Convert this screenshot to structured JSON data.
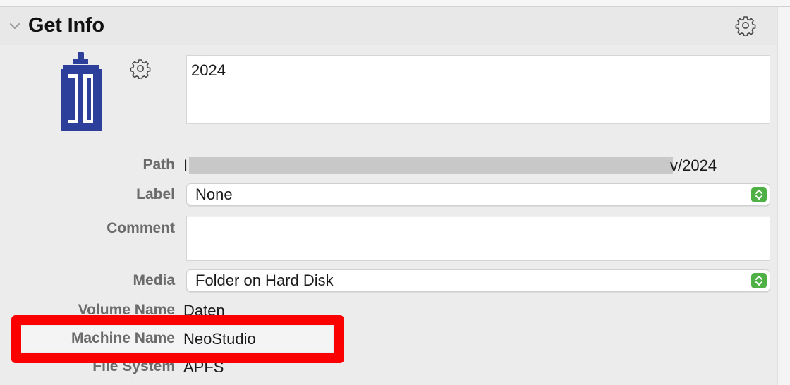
{
  "window": {
    "title": "Get Info"
  },
  "icons": {
    "disclosure": "chevron-down-icon",
    "header_action": "gear-icon",
    "folder": "folder-custom-icon",
    "icon_action": "gear-icon"
  },
  "name_field": {
    "value": "2024"
  },
  "info": {
    "path": {
      "label": "Path",
      "value_start": "I",
      "value_end": "v/2024"
    },
    "label": {
      "label": "Label",
      "value": "None"
    },
    "comment": {
      "label": "Comment",
      "value": ""
    },
    "media": {
      "label": "Media",
      "value": "Folder on Hard Disk"
    },
    "volume_name": {
      "label": "Volume Name",
      "value": "Daten"
    },
    "machine_name": {
      "label": "Machine Name",
      "value": "NeoStudio"
    },
    "file_system": {
      "label": "File System",
      "value": "APFS"
    }
  },
  "colors": {
    "highlight": "#fb0000",
    "folder_icon": "#2c3f9a",
    "stepper": "#4fb045"
  }
}
